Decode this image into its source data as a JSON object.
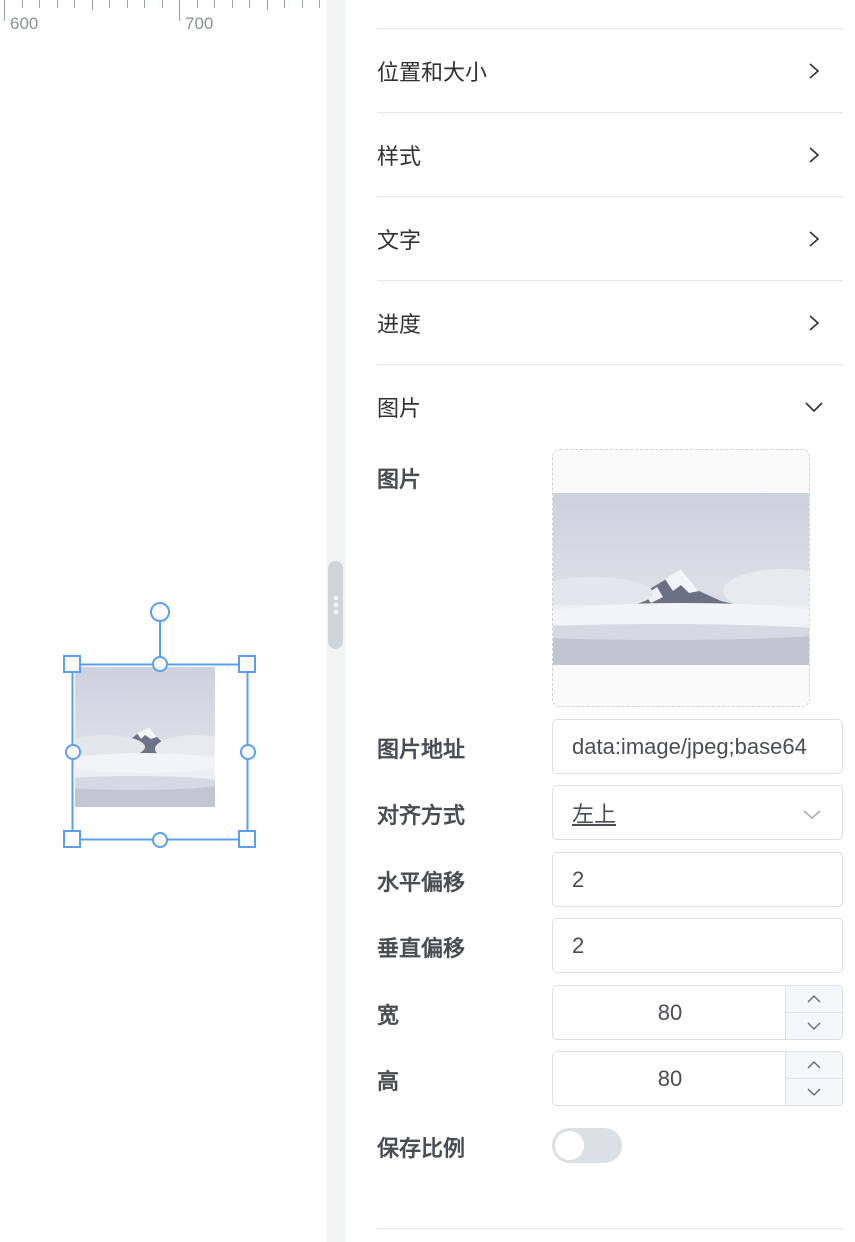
{
  "ruler": {
    "labels": [
      "600",
      "700"
    ]
  },
  "canvas": {
    "image_icon": "mountain-photo-icon"
  },
  "panel": {
    "sections": [
      {
        "title": "位置和大小",
        "state": "collapsed"
      },
      {
        "title": "样式",
        "state": "collapsed"
      },
      {
        "title": "文字",
        "state": "collapsed"
      },
      {
        "title": "进度",
        "state": "collapsed"
      },
      {
        "title": "图片",
        "state": "expanded"
      }
    ],
    "image_form": {
      "image_label": "图片",
      "url_label": "图片地址",
      "url_value": "data:image/jpeg;base64",
      "align_label": "对齐方式",
      "align_value": "左上",
      "offset_x_label": "水平偏移",
      "offset_x_value": "2",
      "offset_y_label": "垂直偏移",
      "offset_y_value": "2",
      "width_label": "宽",
      "width_value": "80",
      "height_label": "高",
      "height_value": "80",
      "keep_ratio_label": "保存比例",
      "keep_ratio_on": false
    }
  },
  "colors": {
    "accent": "#5a9ff5",
    "border": "#dcdfe6",
    "label": "#4a4d53",
    "switch_off": "#dcdfe6"
  }
}
